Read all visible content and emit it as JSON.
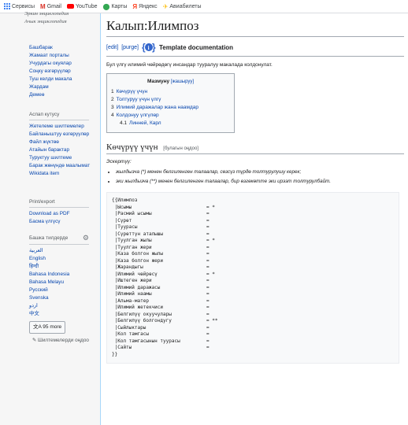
{
  "bookmarks": [
    {
      "label": "Сервисы",
      "icon": "apps-icon",
      "color": "#4285f4"
    },
    {
      "label": "Gmail",
      "icon": "gmail-icon",
      "color": "#d93025"
    },
    {
      "label": "YouTube",
      "icon": "youtube-icon",
      "color": "#ff0000"
    },
    {
      "label": "Карты",
      "icon": "maps-icon",
      "color": "#34a853"
    },
    {
      "label": "Яндекс",
      "icon": "yandex-icon",
      "color": "#fc3f1d"
    },
    {
      "label": "Авиабилеты",
      "icon": "plane-icon",
      "color": "#fbbc04"
    }
  ],
  "sidebar": {
    "logo_clip": "Эркин энциклопедия",
    "logo_text": "Ачык энциклопедия",
    "nav": [
      "Башбарак",
      "Жамаат порталы",
      "Учурдагы окуялар",
      "Соңку өзгөрүүлөр",
      "Туш келди макала",
      "Жардам",
      "Демеө"
    ],
    "tools_head": "Аспап кутусу",
    "tools": [
      "Жетелеме шилтемелер",
      "Байланыштуу өзгөрүүлөр",
      "Файл жүктөө",
      "Атайын барактар",
      "Туруктуу шилтеме",
      "Барак жөнүндө маалымат",
      "Wikidata item"
    ],
    "print_head": "Print/export",
    "print": [
      "Download as PDF",
      "Басма үлгүсү"
    ],
    "lang_head": "Башка тилдерде",
    "languages": [
      "العربية",
      "English",
      "हिन्दी",
      "Bahasa Indonesia",
      "Bahasa Melayu",
      "Русский",
      "Svenska",
      "اردو",
      "中文"
    ],
    "more_label": "95 more",
    "edit_links": "Шилтемелерди оңдоо"
  },
  "content": {
    "title": "Калып:Илимпоз",
    "edit": "[edit]",
    "purge": "[purge]",
    "doc_title": "Template documentation",
    "intro": "Бул үлгү илимий чөйрөдөгү инсандар тууралуу макалада колдонулат.",
    "toc": {
      "title": "Мазмуну",
      "hide": "[жашыруу]",
      "items": [
        {
          "num": "1",
          "label": "Көчүрүү үчүн"
        },
        {
          "num": "2",
          "label": "Толтуруу үчүн үлгү"
        },
        {
          "num": "3",
          "label": "Илимий даражалар жана наамдар"
        },
        {
          "num": "4",
          "label": "Колдонуу үлгүлөр"
        },
        {
          "num": "4.1",
          "label": "Линней, Карл"
        }
      ]
    },
    "section": {
      "title": "Көчүрүү үчүн",
      "edit": "[булагын оңдоо]"
    },
    "note": "Эскертүү:",
    "bullets": [
      "жылдызча (*) менен белгиленген талаалар, сөзсүз түрдө толтурулушу керек;",
      "эки жылдызча (**) менен белгиленген талаалар, бир өзгөкөтте эки ирээт толтурулбайт."
    ],
    "code": {
      "open": "{{Илимпоз",
      "close": "}}",
      "lines": [
        {
          "key": " |Ысымы",
          "val": "= *"
        },
        {
          "key": " |Расмий ысымы",
          "val": "="
        },
        {
          "key": " |Сүрөт",
          "val": "="
        },
        {
          "key": " |Туурасы",
          "val": "="
        },
        {
          "key": " |Сүрөттүн аталышы",
          "val": "="
        },
        {
          "key": " |Туулган жылы",
          "val": "= *"
        },
        {
          "key": " |Туулган жери",
          "val": "="
        },
        {
          "key": " |Каза болгон жылы",
          "val": "="
        },
        {
          "key": " |Каза болгон жери",
          "val": "="
        },
        {
          "key": " |Жарандыгы",
          "val": "="
        },
        {
          "key": " |Илимий чөйрөсү",
          "val": "= *"
        },
        {
          "key": " |Иштеген жери",
          "val": "="
        },
        {
          "key": " |Илимий даражасы",
          "val": "="
        },
        {
          "key": " |Илимий наамы",
          "val": "="
        },
        {
          "key": " |Альма-матер",
          "val": "="
        },
        {
          "key": " |Илимий жетекчиси",
          "val": "="
        },
        {
          "key": " |Белгилүү окуучулары",
          "val": "="
        },
        {
          "key": " |Белгилүү болгондугу",
          "val": "= **"
        },
        {
          "key": " |Сыйлыктары",
          "val": "="
        },
        {
          "key": " |Кол тамгасы",
          "val": "="
        },
        {
          "key": " |Кол тамгасынын туурасы",
          "val": "="
        },
        {
          "key": " |Сайты",
          "val": "="
        }
      ]
    }
  }
}
